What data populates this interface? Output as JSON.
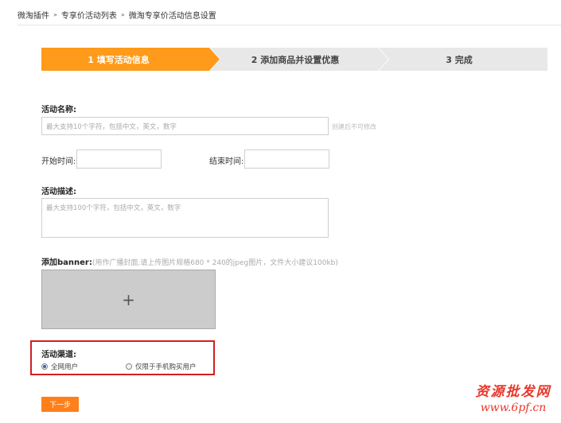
{
  "breadcrumb": [
    "微淘插件",
    "专享价活动列表",
    "微淘专享价活动信息设置"
  ],
  "breadcrumb_separator": "»",
  "steps": [
    {
      "label": "1 填写活动信息",
      "active": true
    },
    {
      "label": "2 添加商品并设置优惠",
      "active": false
    },
    {
      "label": "3 完成",
      "active": false
    }
  ],
  "colors": {
    "active_step": "#ff9a1a",
    "inactive_step": "#e8e8e8",
    "accent": "#ff7f1a",
    "highlight_border": "#d21f1f"
  },
  "form": {
    "name_label": "活动名称:",
    "name_placeholder": "最大支持10个字符，包括中文，英文，数字",
    "name_note": "创建后不可修改",
    "start_label": "开始时间:",
    "end_label": "结束时间:",
    "desc_label": "活动描述:",
    "desc_placeholder": "最大支持100个字符，包括中文，英文，数字",
    "banner_label": "添加banner:",
    "banner_hint": "(用作广播封面,请上传图片规格680 * 240的jpeg图片，文件大小建议100kb)",
    "upload_symbol": "+",
    "channel_label": "活动渠道:",
    "channel_options": [
      {
        "label": "全网用户",
        "selected": true
      },
      {
        "label": "仅限于手机购买用户",
        "selected": false
      }
    ],
    "next_button": "下一步"
  },
  "watermark": {
    "line1": "资源批发网",
    "line2": "www.6pf.cn"
  }
}
